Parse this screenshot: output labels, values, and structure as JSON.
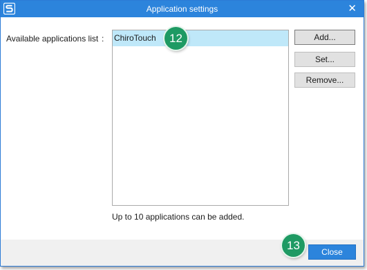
{
  "window": {
    "title": "Application settings",
    "close_glyph": "✕",
    "accent_color": "#2c84dc"
  },
  "main": {
    "list_label": "Available applications list",
    "list_colon": ":",
    "applications": [
      {
        "label": "ChiroTouch",
        "selected": true
      }
    ],
    "limit_note": "Up to 10 applications can be added."
  },
  "buttons": {
    "add": "Add...",
    "set": "Set...",
    "remove": "Remove...",
    "close": "Close"
  },
  "callouts": {
    "first": "12",
    "second": "13",
    "color": "#1e9a63"
  },
  "icons": {
    "app": "scansnap-s-logo-icon",
    "close": "close-icon"
  }
}
